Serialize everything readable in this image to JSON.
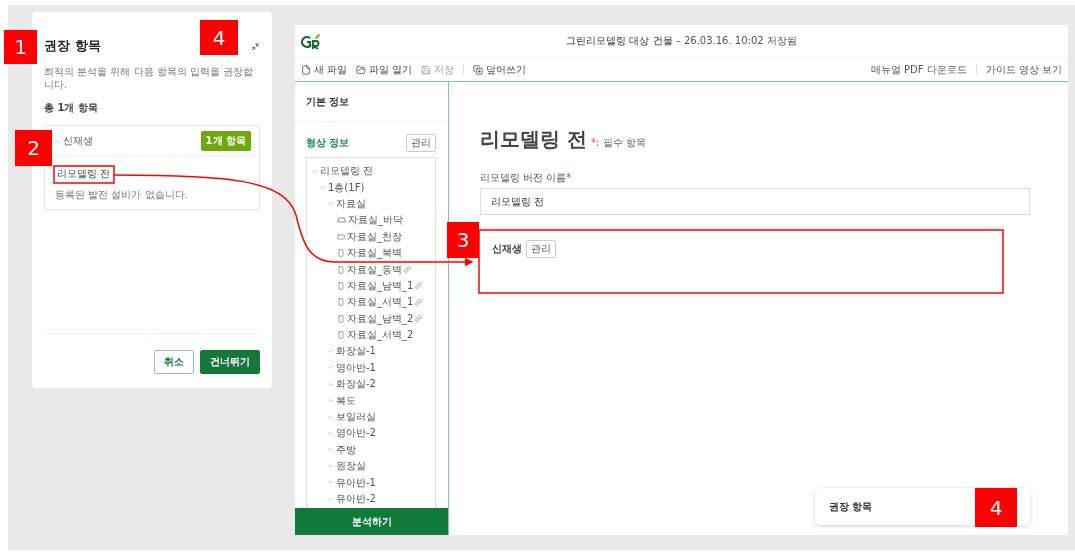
{
  "recommend_panel": {
    "title": "권장 항목",
    "description": "최적의 분석을 위해 다음 항목의 입력을 권장합니다.",
    "total": "총 1개 항목",
    "groups": [
      {
        "label": "신재생",
        "expanded": true,
        "badge": "1개 항목",
        "items": [
          {
            "label": "리모델링 전",
            "note": "등록된 발전 설비가 없습니다."
          }
        ]
      }
    ],
    "buttons": [
      {
        "label": "취소",
        "kind": "secondary"
      },
      {
        "label": "건너뛰기",
        "kind": "primary"
      }
    ]
  },
  "app": {
    "title": "그린리모델링 대상 건물",
    "saved": "– 26.03.16. 10:02 저장됨",
    "toolbar": [
      {
        "label": "새 파일",
        "kind": "new",
        "disabled": false
      },
      {
        "label": "파일 열기",
        "kind": "open",
        "disabled": false
      },
      {
        "label": "저장",
        "kind": "save",
        "disabled": true
      },
      {
        "label": "덮어쓰기",
        "kind": "overwrite",
        "disabled": false
      }
    ],
    "links": [
      "매뉴얼 PDF 다운로드",
      "가이드 영상 보기"
    ],
    "sidebar": {
      "basic": "기본 정보",
      "shape": "형상 정보",
      "manage": "관리",
      "analyze": "분석하기",
      "tree": [
        {
          "label": "리모델링 전",
          "kind": "group",
          "expanded": true,
          "children": [
            {
              "label": "1층(1F)",
              "kind": "group",
              "expanded": true,
              "children": [
                {
                  "label": "자료실",
                  "kind": "group",
                  "expanded": true,
                  "children": [
                    {
                      "label": "자료실_바닥",
                      "kind": "floor",
                      "linked": false
                    },
                    {
                      "label": "자료실_천장",
                      "kind": "ceiling",
                      "linked": false
                    },
                    {
                      "label": "자료실_북벽",
                      "kind": "wall",
                      "linked": false
                    },
                    {
                      "label": "자료실_동벽",
                      "kind": "wall",
                      "linked": true
                    },
                    {
                      "label": "자료실_남벽_1",
                      "kind": "wall",
                      "linked": true
                    },
                    {
                      "label": "자료실_서벽_1",
                      "kind": "wall",
                      "linked": true
                    },
                    {
                      "label": "자료실_남벽_2",
                      "kind": "wall",
                      "linked": true
                    },
                    {
                      "label": "자료실_서벽_2",
                      "kind": "wall",
                      "linked": false
                    }
                  ]
                },
                {
                  "label": "화장실-1",
                  "kind": "group",
                  "expanded": false
                },
                {
                  "label": "영아반-1",
                  "kind": "group",
                  "expanded": false
                },
                {
                  "label": "화장실-2",
                  "kind": "group",
                  "expanded": false
                },
                {
                  "label": "복도",
                  "kind": "group",
                  "expanded": false
                },
                {
                  "label": "보일러실",
                  "kind": "group",
                  "expanded": false
                },
                {
                  "label": "영아반-2",
                  "kind": "group",
                  "expanded": false
                },
                {
                  "label": "주방",
                  "kind": "group",
                  "expanded": false
                },
                {
                  "label": "원장실",
                  "kind": "group",
                  "expanded": false
                },
                {
                  "label": "유아반-1",
                  "kind": "group",
                  "expanded": false
                },
                {
                  "label": "유아반-2",
                  "kind": "group",
                  "expanded": false
                }
              ]
            }
          ]
        }
      ]
    },
    "main": {
      "heading": "리모델링 전",
      "required_mark": "*",
      "required_note": ": 필수 항목",
      "field_label": "리모델링 버전 이름",
      "field_value": "리모델링 전",
      "section": "신재생",
      "section_button": "관리"
    },
    "mini_panel": {
      "title": "권장 항목"
    }
  },
  "callouts": [
    {
      "label": "1"
    },
    {
      "label": "4"
    },
    {
      "label": "2"
    },
    {
      "label": "3"
    },
    {
      "label": "4"
    }
  ]
}
